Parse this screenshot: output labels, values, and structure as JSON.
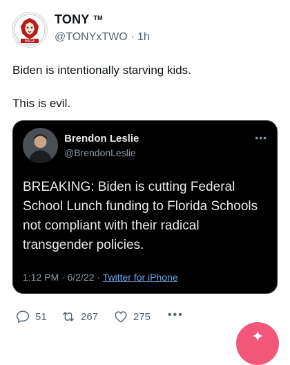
{
  "tweet": {
    "author_name": "TONY",
    "author_badge": "TM",
    "avatar_text": "MAGA",
    "handle": "@TONYxTWO",
    "time": "1h",
    "text_line1": "Biden is intentionally starving kids.",
    "text_line2": "This is evil."
  },
  "quoted": {
    "author_name": "Brendon Leslie",
    "handle": "@BrendonLeslie",
    "more_icon": "ellipsis-icon",
    "text": "BREAKING: Biden is cutting Federal School Lunch funding to Florida Schools not compliant with their radical transgender policies.",
    "timestamp": "1:12 PM · 6/2/22 ·",
    "source": "Twitter for iPhone"
  },
  "actions": {
    "replies": "51",
    "retweets": "267",
    "likes": "275"
  },
  "colors": {
    "text": "#0f1419",
    "secondary": "#536471",
    "quote_bg": "#000000",
    "link": "#6aa9e9",
    "fab": "#f2577a"
  }
}
